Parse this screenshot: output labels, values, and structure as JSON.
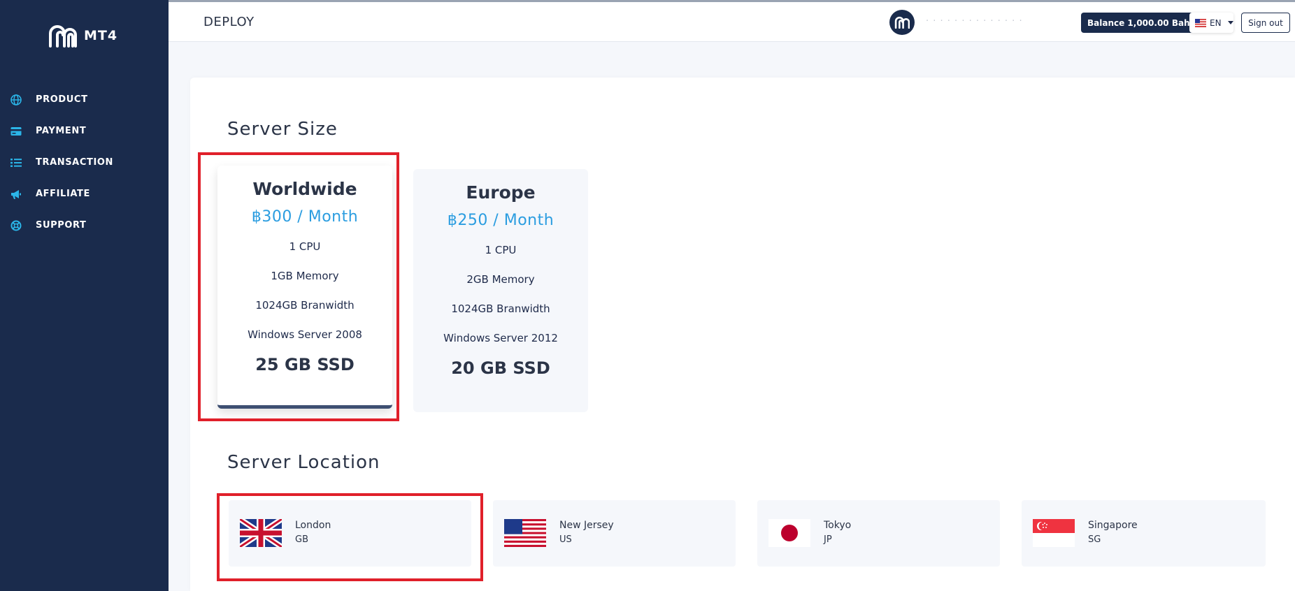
{
  "app": {
    "brand": "MT4",
    "page_title": "DEPLOY"
  },
  "sidebar": {
    "items": [
      {
        "label": "PRODUCT",
        "icon": "globe-icon"
      },
      {
        "label": "PAYMENT",
        "icon": "credit-card-icon"
      },
      {
        "label": "TRANSACTION",
        "icon": "list-icon"
      },
      {
        "label": "AFFILIATE",
        "icon": "megaphone-icon"
      },
      {
        "label": "SUPPORT",
        "icon": "lifebuoy-icon"
      }
    ]
  },
  "header": {
    "username": "· · · ·  · · · · · · · · · ·",
    "balance_label": "Balance 1,000.00 Baht",
    "language": "EN",
    "signout_label": "Sign out"
  },
  "server_size": {
    "title": "Server Size",
    "plans": [
      {
        "name": "Worldwide",
        "price": "฿300 / Month",
        "cpu": "1 CPU",
        "memory": "1GB Memory",
        "bandwidth": "1024GB Branwidth",
        "os": "Windows Server 2008",
        "storage": "25 GB SSD",
        "selected": true
      },
      {
        "name": "Europe",
        "price": "฿250 / Month",
        "cpu": "1 CPU",
        "memory": "2GB Memory",
        "bandwidth": "1024GB Branwidth",
        "os": "Windows Server 2012",
        "storage": "20 GB SSD",
        "selected": false
      }
    ]
  },
  "server_location": {
    "title": "Server Location",
    "locations": [
      {
        "city": "London",
        "code": "GB",
        "flag": "uk-flag-icon",
        "selected": true
      },
      {
        "city": "New Jersey",
        "code": "US",
        "flag": "us-flag-icon",
        "selected": false
      },
      {
        "city": "Tokyo",
        "code": "JP",
        "flag": "japan-flag-icon",
        "selected": false
      },
      {
        "city": "Singapore",
        "code": "SG",
        "flag": "singapore-flag-icon",
        "selected": false
      }
    ]
  },
  "colors": {
    "sidebar_bg": "#1a2b4c",
    "accent_price": "#2b9de0",
    "icon_cyan": "#2bb5e8",
    "highlight_red": "#e0202a"
  }
}
